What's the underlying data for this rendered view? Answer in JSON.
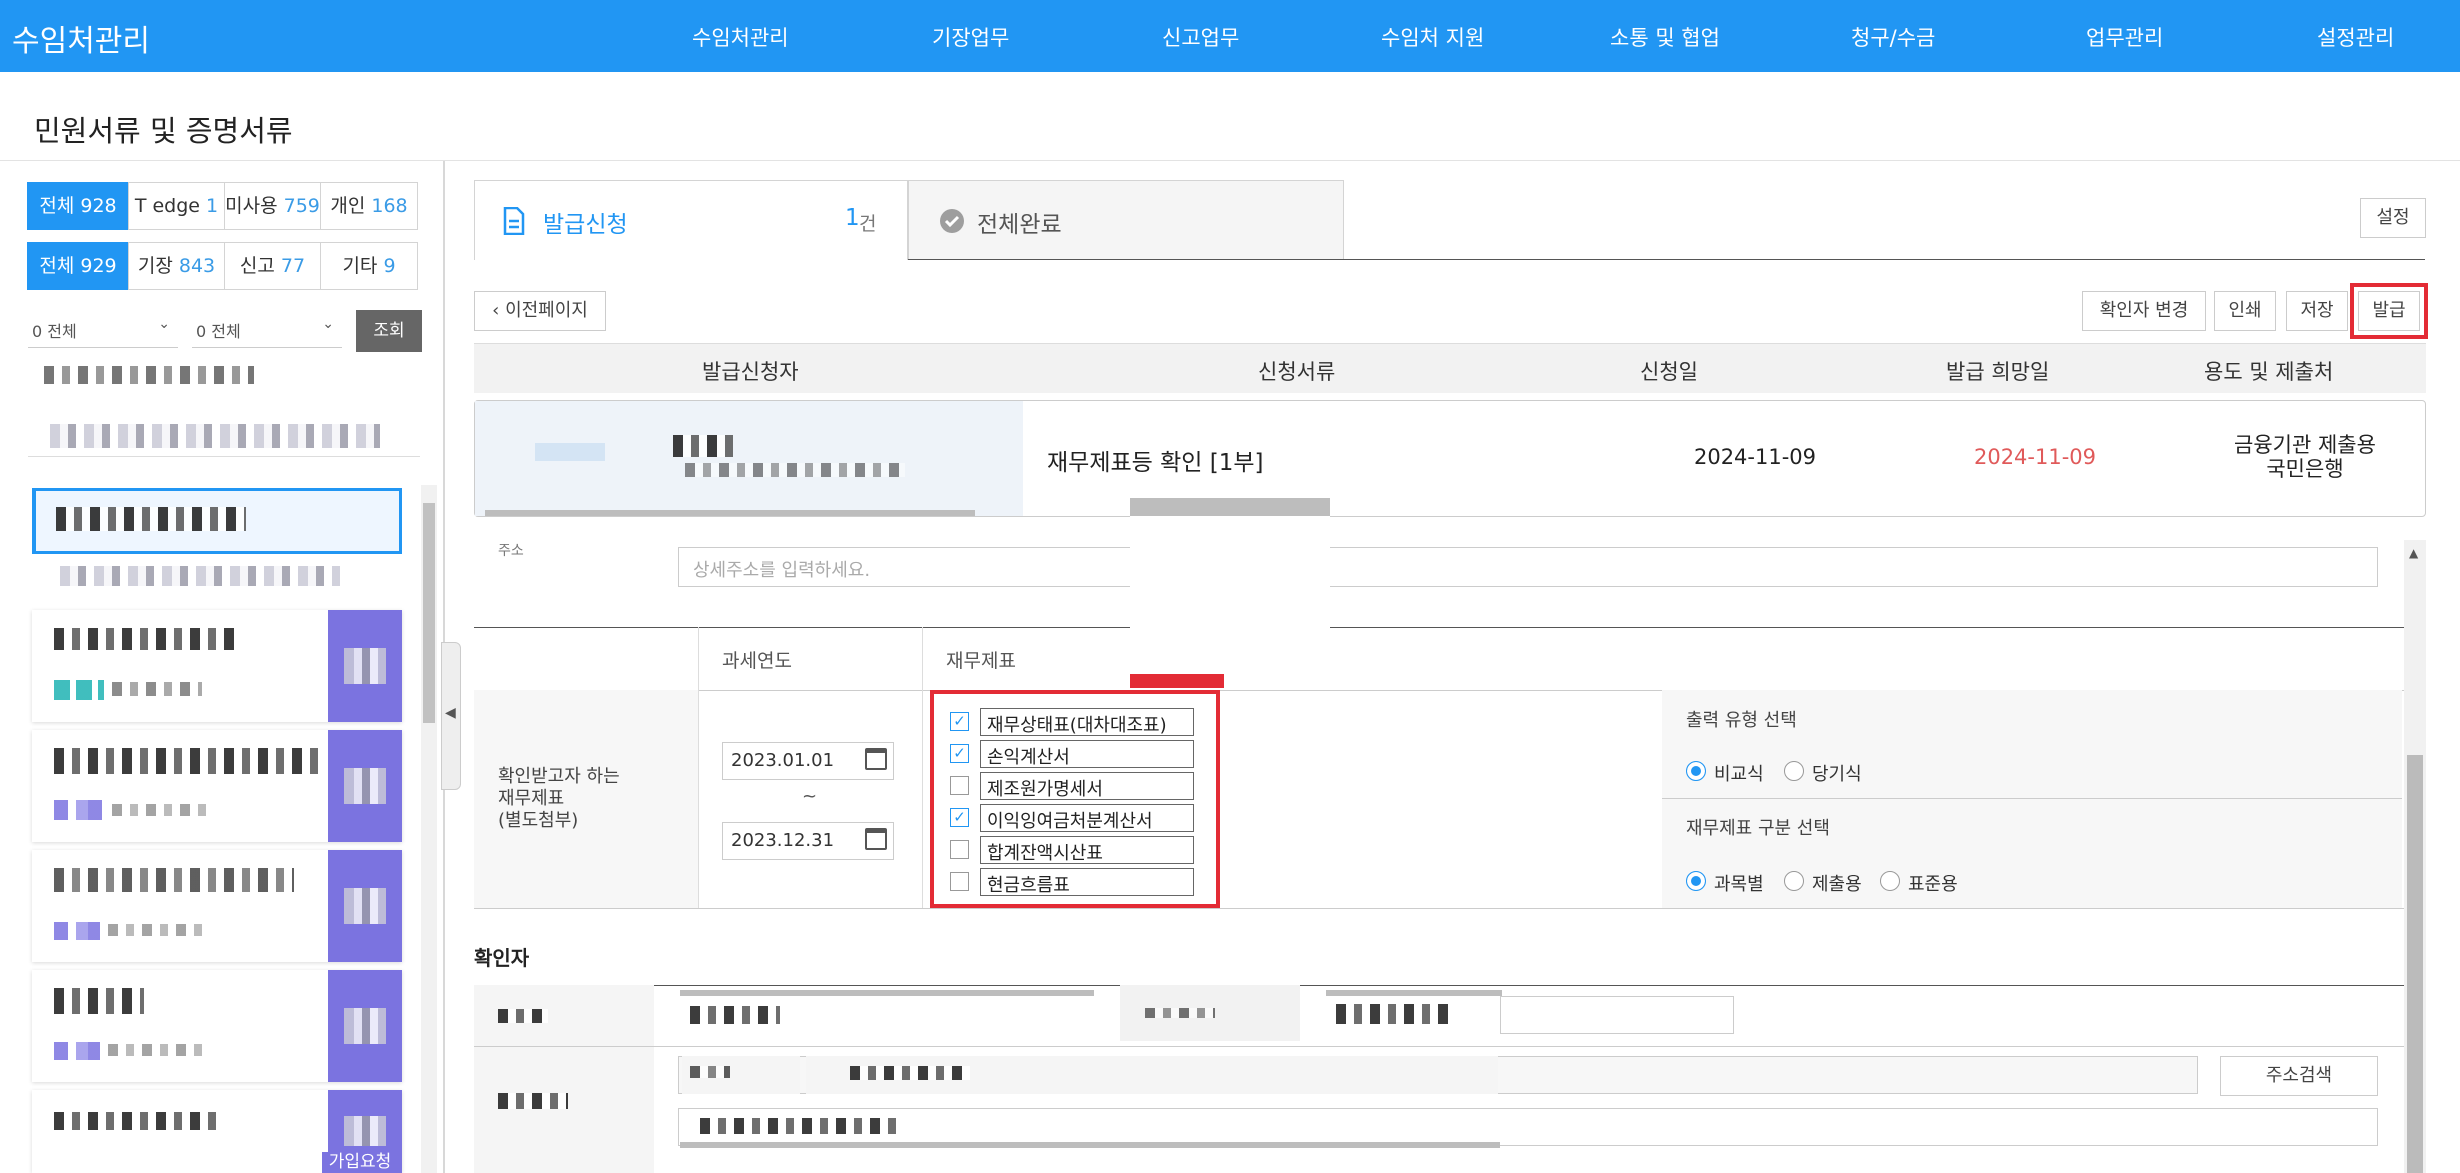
{
  "nav": {
    "brand": "수임처관리",
    "items": [
      "수임처관리",
      "기장업무",
      "신고업무",
      "수임처 지원",
      "소통 및 협업",
      "청구/수금",
      "업무관리",
      "설정관리"
    ]
  },
  "page": {
    "title": "민원서류 및 증명서류"
  },
  "left": {
    "row1": [
      {
        "label": "전체",
        "count": "928"
      },
      {
        "label": "T edge",
        "count": "1"
      },
      {
        "label": "미사용",
        "count": "759"
      },
      {
        "label": "개인",
        "count": "168"
      }
    ],
    "row2": [
      {
        "label": "전체",
        "count": "929"
      },
      {
        "label": "기장",
        "count": "843"
      },
      {
        "label": "신고",
        "count": "77"
      },
      {
        "label": "기타",
        "count": "9"
      }
    ],
    "filter1": "0 전체",
    "filter2": "0 전체",
    "search_btn": "조회",
    "join_badge": "가입요청"
  },
  "tabs": {
    "active_label": "발급신청",
    "active_count": "1",
    "active_unit": "건",
    "inactive_label": "전체완료",
    "settings": "설정"
  },
  "toolbar": {
    "back": "이전페이지",
    "change_checker": "확인자 변경",
    "print": "인쇄",
    "save": "저장",
    "issue": "발급"
  },
  "table": {
    "headers": [
      "발급신청자",
      "신청서류",
      "신청일",
      "발급 희망일",
      "용도 및 제출처"
    ],
    "row": {
      "document": "재무제표등 확인 [1부]",
      "apply_date": "2024-11-09",
      "desired_date": "2024-11-09",
      "purpose_line1": "금융기관 제출용",
      "purpose_line2": "국민은행"
    }
  },
  "detail": {
    "address_label": "주소",
    "address_placeholder": "상세주소를 입력하세요.",
    "col_tax_year": "과세연도",
    "col_statements": "재무제표",
    "row_label_lines": [
      "확인받고자 하는",
      "재무제표",
      "(별도첨부)"
    ],
    "date_from": "2023.01.01",
    "tilde": "~",
    "date_to": "2023.12.31",
    "statements": [
      {
        "label": "재무상태표(대차대조표)",
        "checked": true
      },
      {
        "label": "손익계산서",
        "checked": true
      },
      {
        "label": "제조원가명세서",
        "checked": false
      },
      {
        "label": "이익잉여금처분계산서",
        "checked": true
      },
      {
        "label": "합계잔액시산표",
        "checked": false
      },
      {
        "label": "현금흐름표",
        "checked": false
      }
    ],
    "output_type_title": "출력 유형 선택",
    "output_type_options": [
      {
        "label": "비교식",
        "selected": true
      },
      {
        "label": "당기식",
        "selected": false
      }
    ],
    "statement_type_title": "재무제표 구분 선택",
    "statement_type_options": [
      {
        "label": "과목별",
        "selected": true
      },
      {
        "label": "제출용",
        "selected": false
      },
      {
        "label": "표준용",
        "selected": false
      }
    ],
    "checker_section": "확인자",
    "address_search": "주소검색"
  },
  "colors": {
    "primary": "#2196f3",
    "highlight_red": "#e32b35",
    "badge_purple": "#7b73e0",
    "date_red": "#e05a5a"
  }
}
